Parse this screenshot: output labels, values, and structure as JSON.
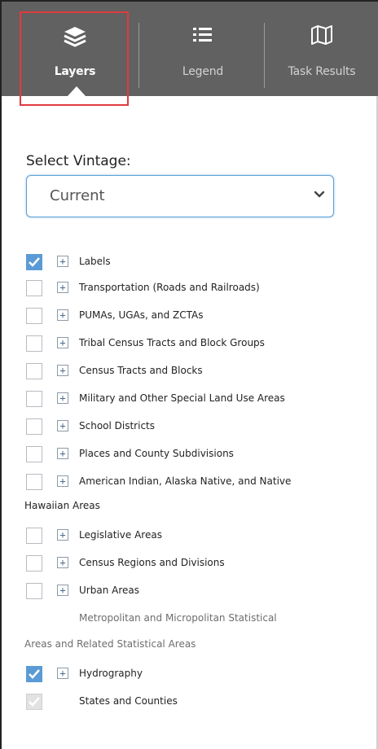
{
  "tabs": [
    {
      "label": "Layers",
      "icon": "layers-icon",
      "active": true
    },
    {
      "label": "Legend",
      "icon": "list-icon",
      "active": false
    },
    {
      "label": "Task Results",
      "icon": "map-icon",
      "active": false
    }
  ],
  "vintage": {
    "label": "Select Vintage:",
    "selected": "Current"
  },
  "layers": [
    {
      "label": "Labels",
      "checked": true
    },
    {
      "label": "Transportation (Roads and Railroads)",
      "checked": false
    },
    {
      "label": "PUMAs, UGAs, and ZCTAs",
      "checked": false
    },
    {
      "label": "Tribal Census Tracts and Block Groups",
      "checked": false
    },
    {
      "label": "Census Tracts and Blocks",
      "checked": false
    },
    {
      "label": "Military and Other Special Land Use Areas",
      "checked": false
    },
    {
      "label": "School Districts",
      "checked": false
    },
    {
      "label": "Places and County Subdivisions",
      "checked": false
    },
    {
      "label": "American Indian, Alaska Native, and Native",
      "label_continued": "Hawaiian Areas",
      "checked": false
    },
    {
      "label": "Legislative Areas",
      "checked": false
    },
    {
      "label": "Census Regions and Divisions",
      "checked": false
    },
    {
      "label": "Urban Areas",
      "checked": false
    },
    {
      "label": "Metropolitan and Micropolitan Statistical",
      "label_continued": "Areas and Related Statistical Areas",
      "checked": false,
      "no_controls": true
    },
    {
      "label": "Hydrography",
      "checked": true
    },
    {
      "label": "States and Counties",
      "checked": true,
      "disabled": true
    }
  ],
  "colors": {
    "tabbar_bg": "#616161",
    "highlight_border": "#e03a3e",
    "checkbox_checked": "#5b9bd5",
    "select_border": "#5a9fd6"
  }
}
